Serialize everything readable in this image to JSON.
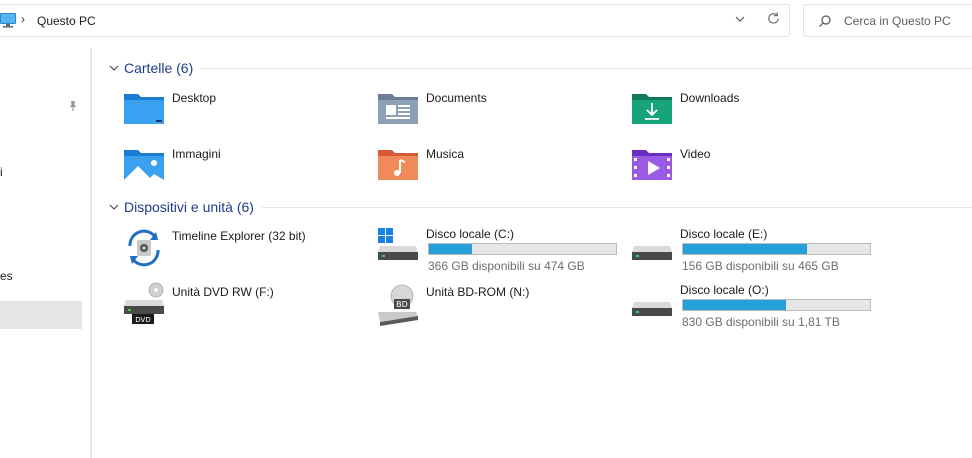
{
  "address": {
    "location": "Questo PC",
    "separator": "›"
  },
  "search": {
    "placeholder": "Cerca in Questo PC"
  },
  "nav": {
    "fragments": [
      "i",
      "es"
    ]
  },
  "groups": {
    "folders": {
      "title": "Cartelle (6)",
      "items": [
        "Desktop",
        "Documents",
        "Downloads",
        "Immagini",
        "Musica",
        "Video"
      ]
    },
    "devices": {
      "title": "Dispositivi e unità (6)",
      "items": [
        {
          "name": "Timeline Explorer (32 bit)"
        },
        {
          "name": "Disco locale (C:)",
          "free": "366 GB disponibili su 474 GB",
          "used_fraction": 0.228
        },
        {
          "name": "Disco locale (E:)",
          "free": "156 GB disponibili su 465 GB",
          "used_fraction": 0.665
        },
        {
          "name": "Unità DVD RW (F:)",
          "badge": "DVD"
        },
        {
          "name": "Unità BD-ROM (N:)",
          "badge": "BD"
        },
        {
          "name": "Disco locale (O:)",
          "free": "830 GB disponibili su 1,81 TB",
          "used_fraction": 0.55
        }
      ]
    }
  },
  "colors": {
    "accent_title": "#1f3c8a",
    "bar_fill": "#26a0da",
    "selection": "#e5e5e5"
  }
}
